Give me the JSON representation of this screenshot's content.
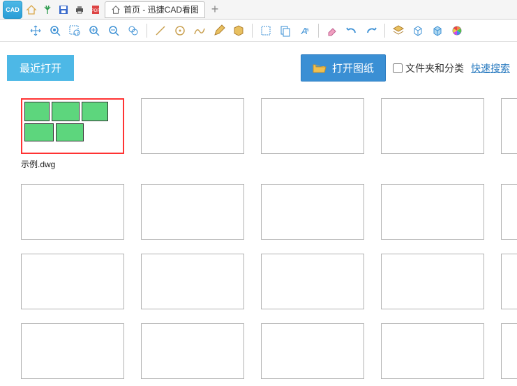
{
  "app": {
    "logo_text": "CAD"
  },
  "tab": {
    "title": "首页 - 迅捷CAD看图"
  },
  "header": {
    "recent_label": "最近打开",
    "open_button": "打开图纸",
    "folder_checkbox": "文件夹和分类",
    "quick_search": "快速搜索"
  },
  "files": [
    {
      "name": "示例.dwg",
      "has_preview": true
    },
    {
      "name": "",
      "has_preview": false
    },
    {
      "name": "",
      "has_preview": false
    },
    {
      "name": "",
      "has_preview": false
    },
    {
      "name": "",
      "has_preview": false
    },
    {
      "name": "",
      "has_preview": false
    },
    {
      "name": "",
      "has_preview": false
    },
    {
      "name": "",
      "has_preview": false
    },
    {
      "name": "",
      "has_preview": false
    },
    {
      "name": "",
      "has_preview": false
    },
    {
      "name": "",
      "has_preview": false
    },
    {
      "name": "",
      "has_preview": false
    },
    {
      "name": "",
      "has_preview": false
    },
    {
      "name": "",
      "has_preview": false
    },
    {
      "name": "",
      "has_preview": false
    },
    {
      "name": "",
      "has_preview": false
    },
    {
      "name": "",
      "has_preview": false
    },
    {
      "name": "",
      "has_preview": false
    },
    {
      "name": "",
      "has_preview": false
    },
    {
      "name": "",
      "has_preview": false
    }
  ],
  "top_icons": [
    "home-icon",
    "palm-icon",
    "save-icon",
    "print-icon",
    "pdf-icon"
  ],
  "toolbar_groups": [
    [
      "pan-icon",
      "zoom-extents-icon",
      "zoom-window-icon",
      "zoom-in-icon",
      "zoom-out-icon",
      "zoom-realtime-icon"
    ],
    [
      "line-icon",
      "circle-icon",
      "polyline-icon",
      "pencil-icon",
      "region-icon"
    ],
    [
      "crop-icon",
      "copy-icon",
      "text-icon"
    ],
    [
      "eraser-icon",
      "undo-icon",
      "redo-icon"
    ],
    [
      "layer-icon",
      "box3d-icon",
      "cube-icon",
      "colorwheel-icon"
    ]
  ]
}
